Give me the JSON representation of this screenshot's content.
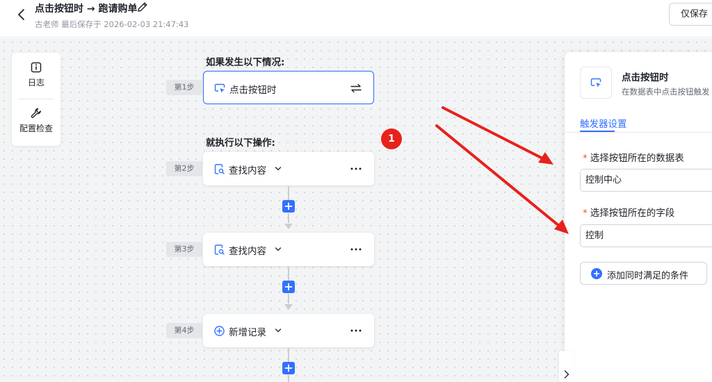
{
  "header": {
    "title": "点击按钮时 → 跑请购单",
    "subtitle": "古老师 最后保存于 2026-02-03 21:47:43",
    "save_label": "仅保存"
  },
  "toolbox": {
    "items": [
      {
        "label": "日志",
        "icon": "info-icon"
      },
      {
        "label": "配置检查",
        "icon": "wrench-icon"
      }
    ]
  },
  "flow": {
    "condition_label": "如果发生以下情况:",
    "action_label": "就执行以下操作:",
    "trigger": {
      "step": "第1步",
      "label": "点击按钮时",
      "icon": "button-click-icon"
    },
    "steps": [
      {
        "step": "第2步",
        "label": "查找内容",
        "icon": "find-record-icon"
      },
      {
        "step": "第3步",
        "label": "查找内容",
        "icon": "find-record-icon"
      },
      {
        "step": "第4步",
        "label": "新增记录",
        "icon": "add-record-icon"
      }
    ]
  },
  "annotation": {
    "marker": "1",
    "color": "#e8211c"
  },
  "panel": {
    "title": "点击按钮时",
    "description": "在数据表中点击按钮触发",
    "tab": "触发器设置",
    "fields": [
      {
        "label": "选择按钮所在的数据表",
        "value": "控制中心"
      },
      {
        "label": "选择按钮所在的字段",
        "value": "控制"
      }
    ],
    "add_condition_label": "添加同时满足的条件"
  },
  "colors": {
    "accent": "#3370ff",
    "required": "#f54a45",
    "annotation": "#e8211c"
  }
}
